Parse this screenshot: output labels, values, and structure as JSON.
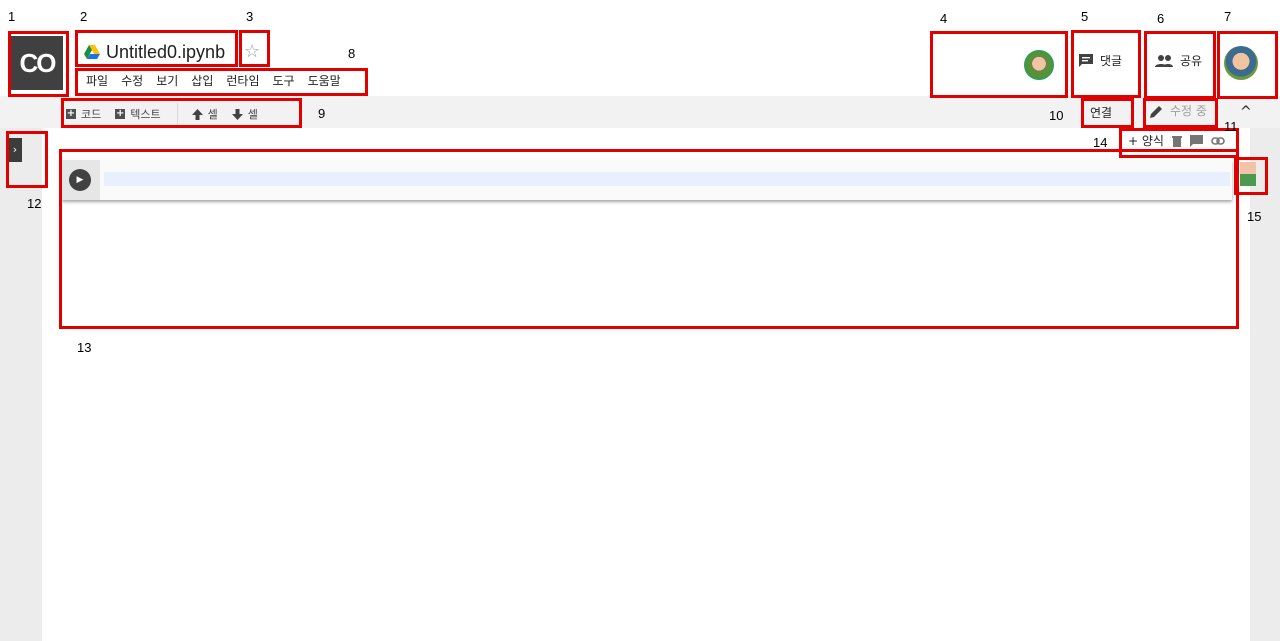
{
  "annotations": [
    "1",
    "2",
    "3",
    "4",
    "5",
    "6",
    "7",
    "8",
    "9",
    "10",
    "11",
    "12",
    "13",
    "14",
    "15"
  ],
  "header": {
    "logo_text": "CO",
    "title": "Untitled0.ipynb",
    "star_icon": "☆",
    "menu": [
      "파일",
      "수정",
      "보기",
      "삽입",
      "런타임",
      "도구",
      "도움말"
    ],
    "comments_label": "댓글",
    "share_label": "공유"
  },
  "toolbar": {
    "add_code_label": "코드",
    "add_text_label": "텍스트",
    "cell_up_label": "셀",
    "cell_down_label": "셀",
    "connect_label": "연결",
    "editing_label": "수정 중",
    "collapse_icon": "^"
  },
  "cell_toolbar": {
    "add_form_label": "+ 양식"
  },
  "icons": {
    "drive": "drive-icon",
    "comment": "comment-icon",
    "people": "people-icon",
    "pencil": "pencil-icon",
    "trash": "trash-icon",
    "link": "link-icon",
    "run": "play-icon"
  }
}
